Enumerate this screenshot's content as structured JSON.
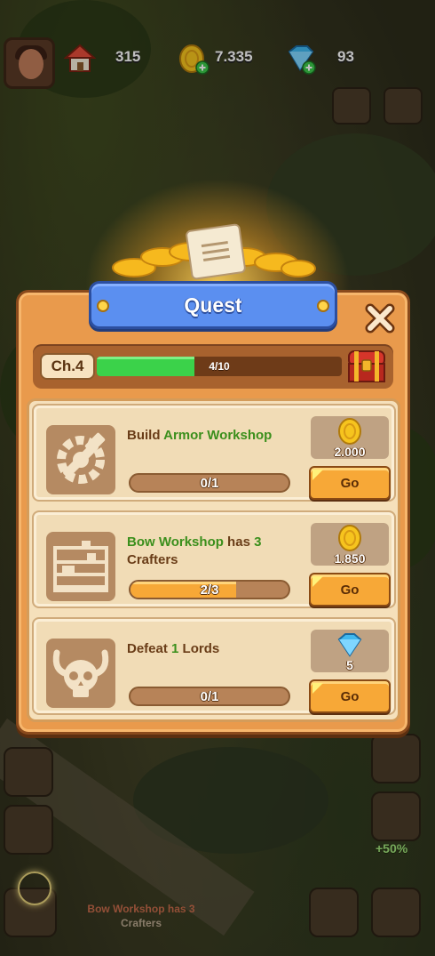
{
  "hud": {
    "houses": "315",
    "gold": "7.335",
    "gems": "93"
  },
  "quest_panel": {
    "title": "Quest",
    "chapter_label": "Ch.4",
    "chapter_progress_text": "4/10",
    "chapter_progress_fraction": 0.4,
    "quests": [
      {
        "title_parts": [
          {
            "text": "Build ",
            "highlight": false
          },
          {
            "text": "Armor Workshop",
            "highlight": true
          }
        ],
        "progress_text": "0/1",
        "progress_fraction": 0,
        "reward_type": "gold",
        "reward_value": "2.000",
        "button_label": "Go",
        "icon": "gear-hammer-icon"
      },
      {
        "title_parts": [
          {
            "text": "Bow Workshop",
            "highlight": true
          },
          {
            "text": " has ",
            "highlight": false
          },
          {
            "text": "3",
            "highlight": true
          },
          {
            "text": " Crafters",
            "highlight": false
          }
        ],
        "progress_text": "2/3",
        "progress_fraction": 0.6667,
        "reward_type": "gold",
        "reward_value": "1.850",
        "button_label": "Go",
        "icon": "workshop-shelf-icon"
      },
      {
        "title_parts": [
          {
            "text": "Defeat ",
            "highlight": false
          },
          {
            "text": "1",
            "highlight": true
          },
          {
            "text": " Lords",
            "highlight": false
          }
        ],
        "progress_text": "0/1",
        "progress_fraction": 0,
        "reward_type": "gem",
        "reward_value": "5",
        "button_label": "Go",
        "icon": "horned-skull-icon"
      }
    ]
  },
  "bottom": {
    "boost_percent": "+50%",
    "message_line1": "Bow Workshop has 3",
    "message_line2": "Crafters"
  },
  "colors": {
    "highlight_green": "#3b8f1c",
    "progress_green": "#3bd24a",
    "progress_orange": "#f7a837",
    "title_blue": "#5b8ff0"
  }
}
